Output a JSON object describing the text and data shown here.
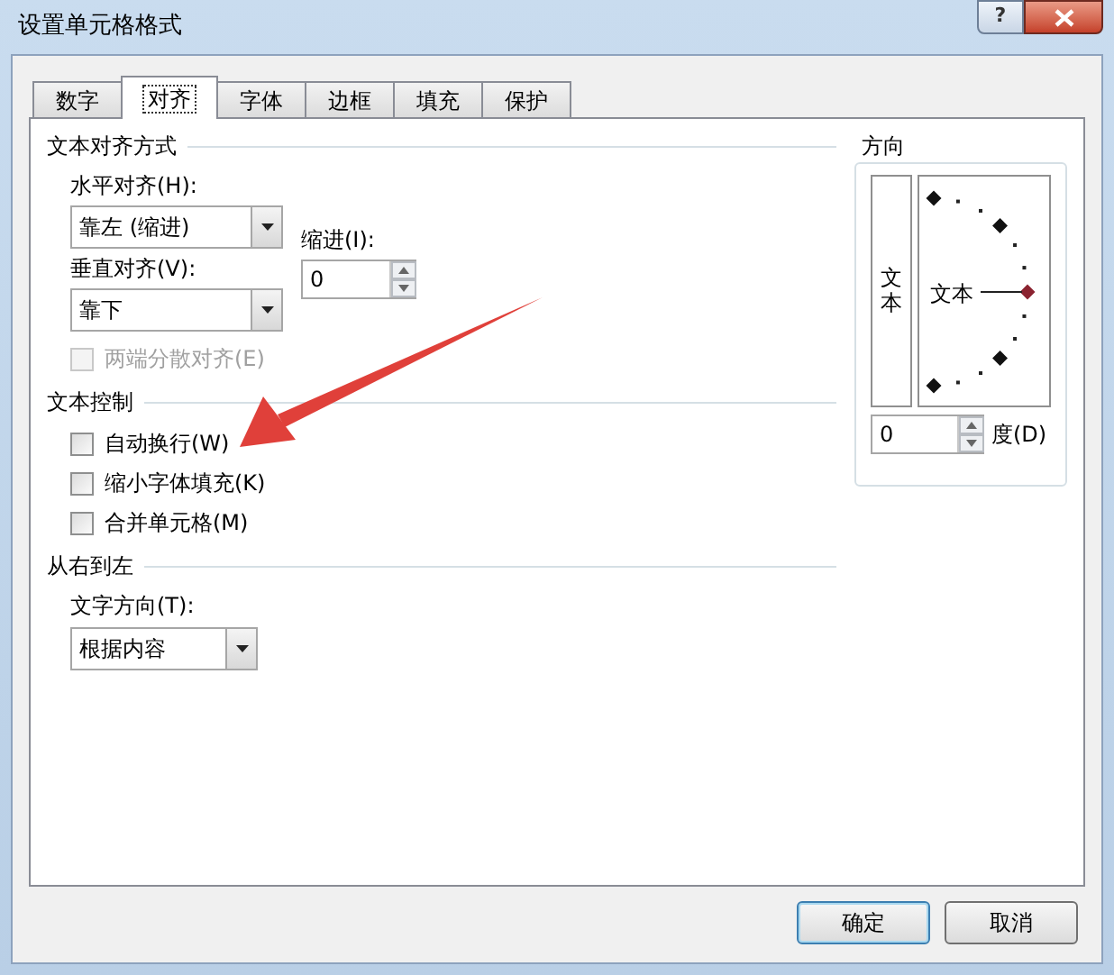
{
  "window": {
    "title": "设置单元格格式",
    "help": "?"
  },
  "tabs": [
    {
      "label": "数字",
      "selected": false
    },
    {
      "label": "对齐",
      "selected": true
    },
    {
      "label": "字体",
      "selected": false
    },
    {
      "label": "边框",
      "selected": false
    },
    {
      "label": "填充",
      "selected": false
    },
    {
      "label": "保护",
      "selected": false
    }
  ],
  "text_alignment": {
    "title": "文本对齐方式",
    "horizontal": {
      "label": "水平对齐(H):",
      "value": "靠左 (缩进)"
    },
    "indent": {
      "label": "缩进(I):",
      "value": "0"
    },
    "vertical": {
      "label": "垂直对齐(V):",
      "value": "靠下"
    },
    "distributed": {
      "label": "两端分散对齐(E)",
      "checked": false,
      "disabled": true
    }
  },
  "text_control": {
    "title": "文本控制",
    "options": [
      {
        "label": "自动换行(W)",
        "checked": false,
        "disabled": false
      },
      {
        "label": "缩小字体填充(K)",
        "checked": false,
        "disabled": false
      },
      {
        "label": "合并单元格(M)",
        "checked": false,
        "disabled": false
      }
    ]
  },
  "right_to_left": {
    "title": "从右到左",
    "direction": {
      "label": "文字方向(T):",
      "value": "根据内容"
    }
  },
  "orientation": {
    "title": "方向",
    "vertical_text": "文本",
    "dial_text": "文本",
    "degrees": {
      "value": "0",
      "label": "度(D)"
    }
  },
  "buttons": [
    {
      "label": "确定",
      "default": true
    },
    {
      "label": "取消",
      "default": false
    }
  ]
}
